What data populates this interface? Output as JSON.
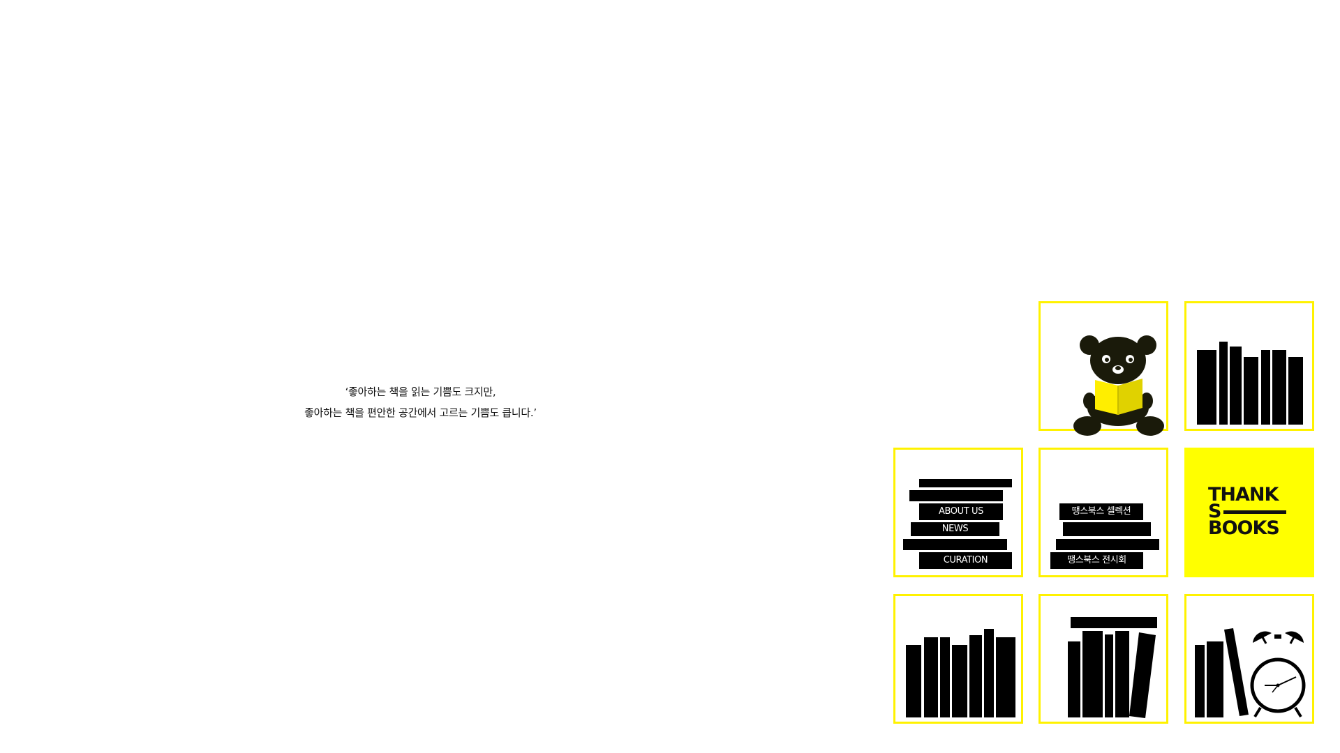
{
  "quote": {
    "line1": "‘좋아하는 책을 읽는 기쁨도 크지만,",
    "line2": "좋아하는 책을 편안한 공간에서 고르는 기쁨도 큽니다.’"
  },
  "menu": {
    "about": "ABOUT US",
    "news": "NEWS",
    "curation": "CURATION",
    "selection": "땡스북스 셀렉션",
    "exhibition": "땡스북스 전시회"
  },
  "logo": {
    "line1": "THANK",
    "line2": "S",
    "line3": "BOOKS"
  },
  "colors": {
    "accent": "#ffff00",
    "border": "#fff200",
    "ink": "#000000"
  },
  "icons": [
    "bear-reading-icon",
    "alarm-clock-icon"
  ]
}
